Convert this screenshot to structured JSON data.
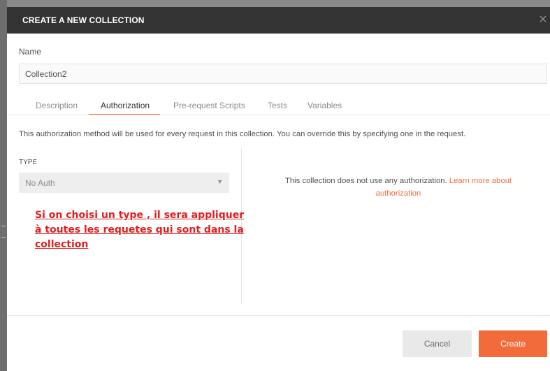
{
  "modal": {
    "title": "CREATE A NEW COLLECTION",
    "close_icon": "close-icon",
    "close_glyph": "×"
  },
  "name": {
    "label": "Name",
    "value": "Collection2"
  },
  "tabs": [
    {
      "label": "Description",
      "active": false
    },
    {
      "label": "Authorization",
      "active": true
    },
    {
      "label": "Pre-request Scripts",
      "active": false
    },
    {
      "label": "Tests",
      "active": false
    },
    {
      "label": "Variables",
      "active": false
    }
  ],
  "auth": {
    "info": "This authorization method will be used for every request in this collection. You can override this by specifying one in the request.",
    "type_label": "TYPE",
    "type_value": "No Auth",
    "caret_icon": "chevron-down-icon",
    "no_auth_text": "This collection does not use any authorization. ",
    "learn_more": "Learn more about authorization"
  },
  "annotation": {
    "text": "Si on choisi un type , il sera appliquer à toutes les requetes qui sont dans la collection",
    "color": "#e02020"
  },
  "footer": {
    "cancel_label": "Cancel",
    "create_label": "Create"
  },
  "colors": {
    "accent": "#f26b3a",
    "header_bg": "#333333"
  }
}
